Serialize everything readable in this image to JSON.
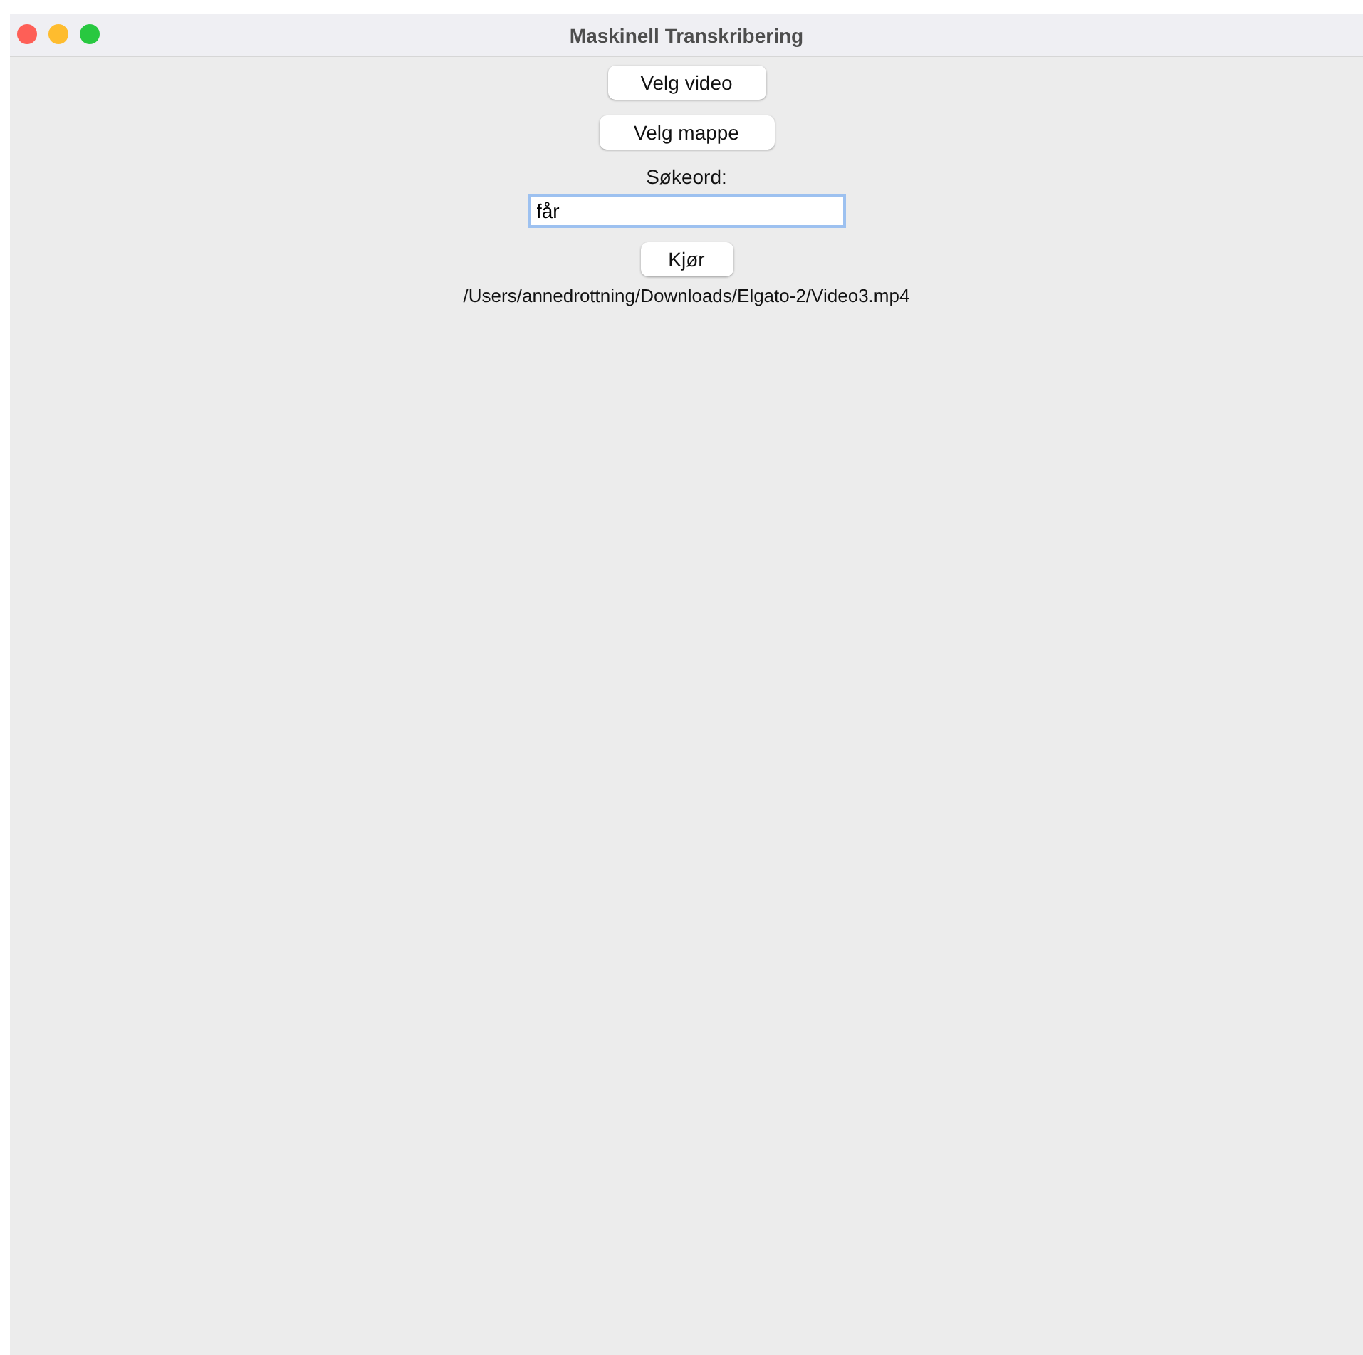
{
  "window": {
    "title": "Maskinell Transkribering"
  },
  "buttons": [
    "Velg video",
    "Velg mappe"
  ],
  "search": {
    "label": "Søkeord:",
    "value": "får",
    "focused": true
  },
  "run_button": "Kjør",
  "path": "/Users/annedrottning/Downloads/Elgato-2/Video3.mp4"
}
